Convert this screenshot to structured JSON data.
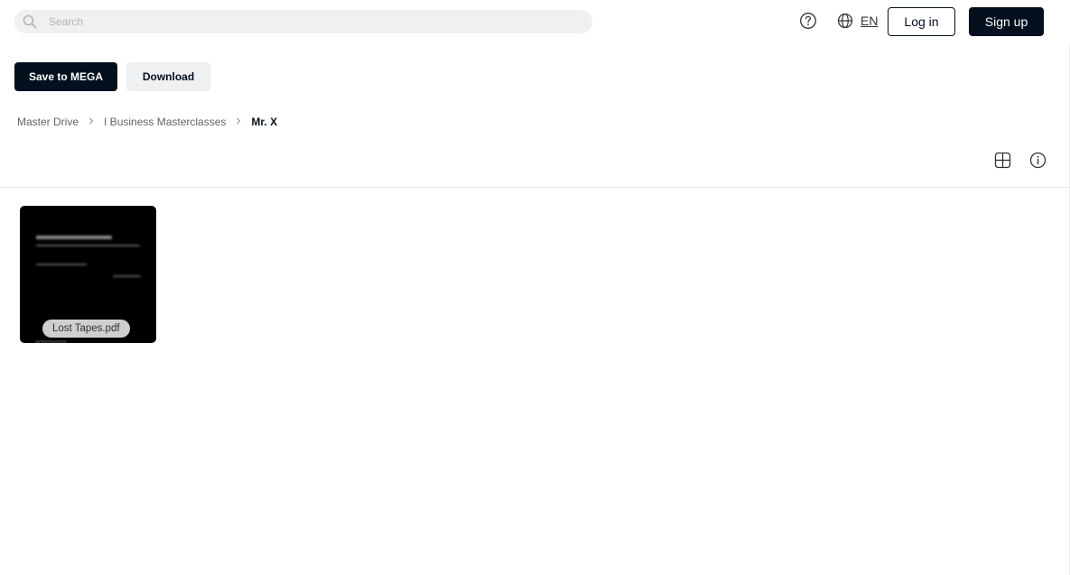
{
  "header": {
    "search": {
      "placeholder": "Search",
      "value": ""
    },
    "language_code": "EN",
    "login_label": "Log in",
    "signup_label": "Sign up"
  },
  "actions": {
    "save_label": "Save to MEGA",
    "download_label": "Download"
  },
  "breadcrumb": [
    {
      "label": "Master Drive"
    },
    {
      "label": "I Business Masterclasses"
    },
    {
      "label": "Mr. X"
    }
  ],
  "files": [
    {
      "name": "Lost Tapes.pdf",
      "icon": "pdf-thumbnail"
    }
  ],
  "colors": {
    "brand_dark": "#04101e",
    "secondary_button": "#eef0f1",
    "search_bg": "#f0f0f0"
  }
}
